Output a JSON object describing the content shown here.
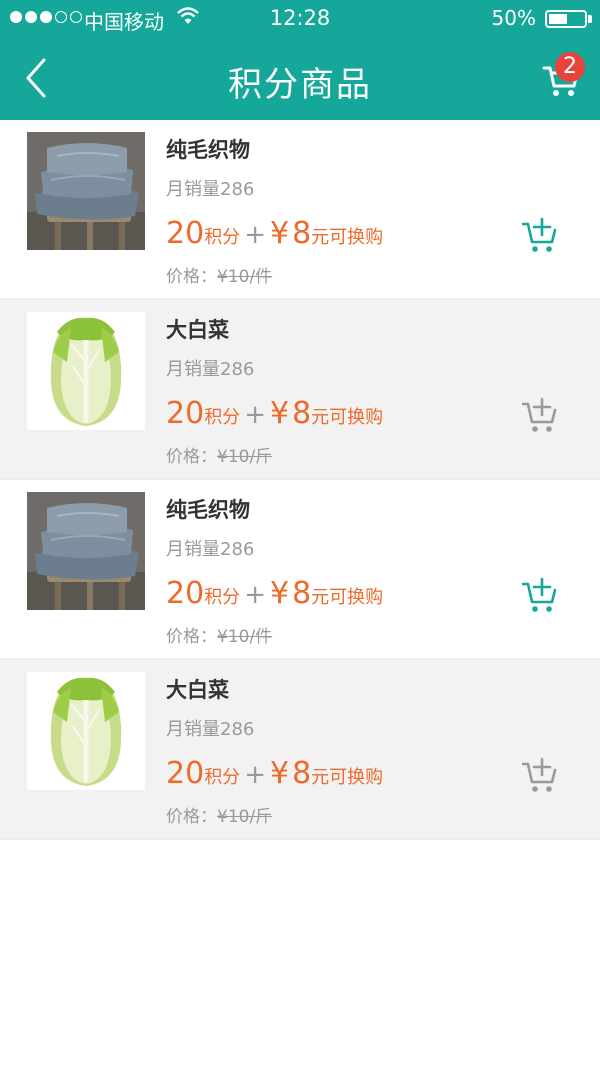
{
  "status_bar": {
    "carrier": "中国移动",
    "time": "12:28",
    "battery": "50%"
  },
  "header": {
    "title": "积分商品",
    "cart_badge": "2"
  },
  "colors": {
    "header_bg": "#14a79a",
    "price": "#ee6a2b",
    "cart_active": "#14a79a",
    "cart_inactive": "#9a9a9a",
    "badge": "#e9443b"
  },
  "products": [
    {
      "name": "纯毛织物",
      "sales": "月销量286",
      "points": "20",
      "points_unit": "积分",
      "plus": "+",
      "yen": "¥",
      "cash": "8",
      "cash_unit": "元可换购",
      "orig_label": "价格：",
      "orig_price": "¥10/件",
      "image": "stacked-pillows",
      "cart_active": true
    },
    {
      "name": "大白菜",
      "sales": "月销量286",
      "points": "20",
      "points_unit": "积分",
      "plus": "+",
      "yen": "¥",
      "cash": "8",
      "cash_unit": "元可换购",
      "orig_label": "价格：",
      "orig_price": "¥10/斤",
      "image": "napa-cabbage",
      "cart_active": false
    },
    {
      "name": "纯毛织物",
      "sales": "月销量286",
      "points": "20",
      "points_unit": "积分",
      "plus": "+",
      "yen": "¥",
      "cash": "8",
      "cash_unit": "元可换购",
      "orig_label": "价格：",
      "orig_price": "¥10/件",
      "image": "stacked-pillows",
      "cart_active": true
    },
    {
      "name": "大白菜",
      "sales": "月销量286",
      "points": "20",
      "points_unit": "积分",
      "plus": "+",
      "yen": "¥",
      "cash": "8",
      "cash_unit": "元可换购",
      "orig_label": "价格：",
      "orig_price": "¥10/斤",
      "image": "napa-cabbage",
      "cart_active": false
    }
  ]
}
